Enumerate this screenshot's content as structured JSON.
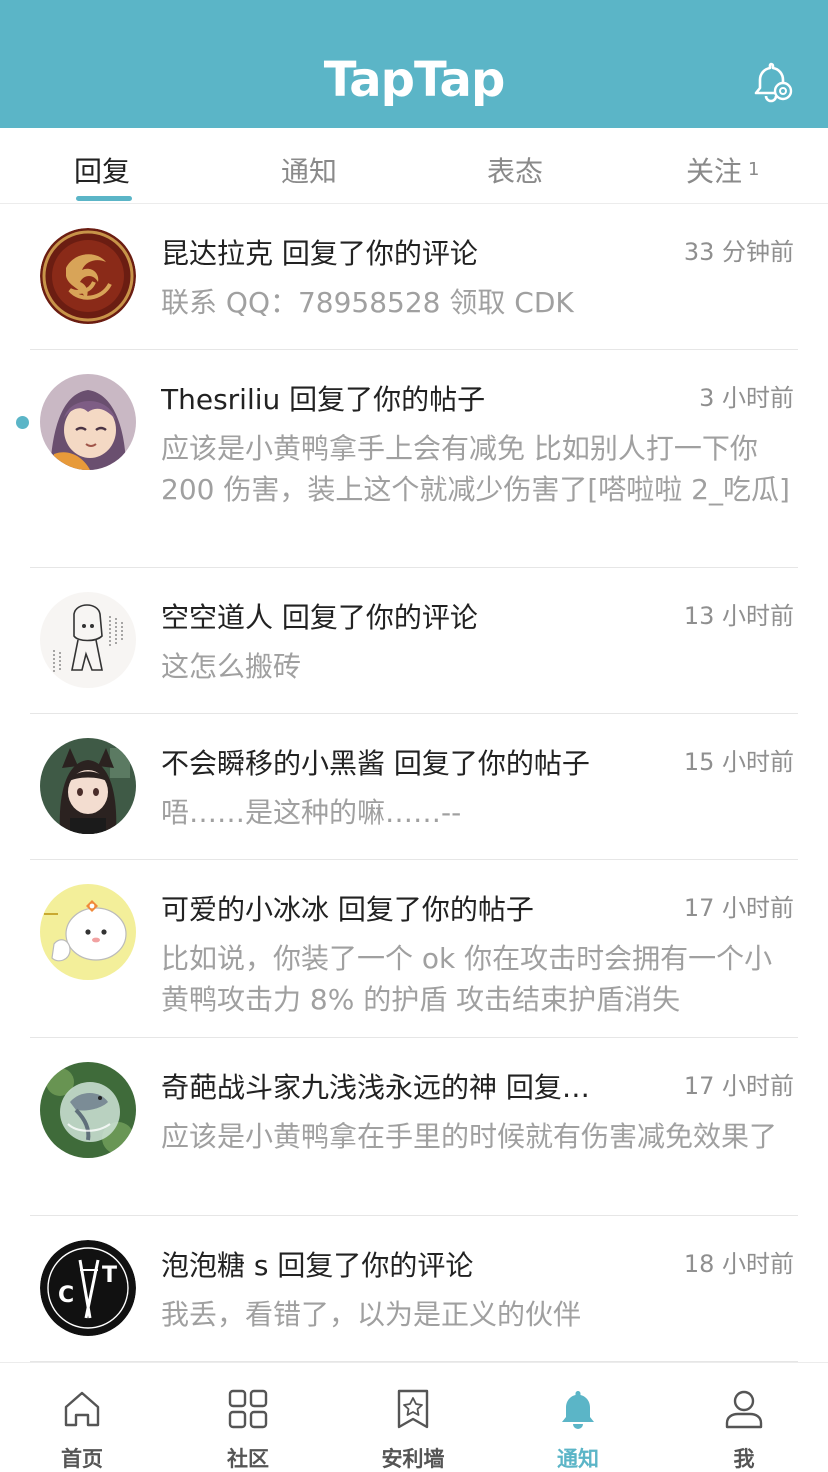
{
  "header": {
    "logo_text": "TapTap",
    "settings_icon": "bell-gear-icon"
  },
  "tabs": [
    {
      "label": "回复",
      "active": true
    },
    {
      "label": "通知",
      "active": false
    },
    {
      "label": "表态",
      "active": false
    },
    {
      "label": "关注",
      "badge": "1",
      "active": false
    }
  ],
  "items": [
    {
      "title": "昆达拉克 回复了你的评论",
      "time": "33 分钟前",
      "body": "联系 QQ：78958528 领取 CDK",
      "unread": false,
      "avatar": "dragon-emblem-avatar"
    },
    {
      "title": "Thesriliu 回复了你的帖子",
      "time": "3 小时前",
      "body": "应该是小黄鸭拿手上会有减免 比如别人打一下你 200 伤害，装上这个就减少伤害了[嗒啦啦 2_吃瓜]",
      "unread": true,
      "avatar": "anime-girl-avatar"
    },
    {
      "title": "空空道人 回复了你的评论",
      "time": "13 小时前",
      "body": "这怎么搬砖",
      "unread": false,
      "avatar": "sketch-character-avatar"
    },
    {
      "title": "不会瞬移的小黑酱 回复了你的帖子",
      "time": "15 小时前",
      "body": "唔……是这种的嘛……--",
      "unread": false,
      "avatar": "cat-ear-girl-avatar"
    },
    {
      "title": "可爱的小冰冰 回复了你的帖子",
      "time": "17 小时前",
      "body": "比如说，你装了一个 ok 你在攻击时会拥有一个小黄鸭攻击力 8% 的护盾 攻击结束护盾消失",
      "unread": false,
      "avatar": "white-bear-avatar"
    },
    {
      "title": "奇葩战斗家九浅浅永远的神 回复…",
      "time": "17 小时前",
      "body": "应该是小黄鸭拿在手里的时候就有伤害减免效果了",
      "unread": false,
      "avatar": "fish-in-glass-avatar"
    },
    {
      "title": "泡泡糖 s 回复了你的评论",
      "time": "18 小时前",
      "body": "我丢，看错了，以为是正义的伙伴",
      "unread": false,
      "avatar": "cat-logo-avatar"
    }
  ],
  "bottom_nav": [
    {
      "label": "首页",
      "icon": "home-icon",
      "active": false
    },
    {
      "label": "社区",
      "icon": "grid-icon",
      "active": false
    },
    {
      "label": "安利墙",
      "icon": "star-bookmark-icon",
      "active": false
    },
    {
      "label": "通知",
      "icon": "bell-icon",
      "active": true
    },
    {
      "label": "我",
      "icon": "person-icon",
      "active": false
    }
  ],
  "colors": {
    "accent": "#5bb5c7",
    "title_text": "#222222",
    "secondary_text": "#a0a0a0",
    "time_text": "#8f8f8f"
  }
}
